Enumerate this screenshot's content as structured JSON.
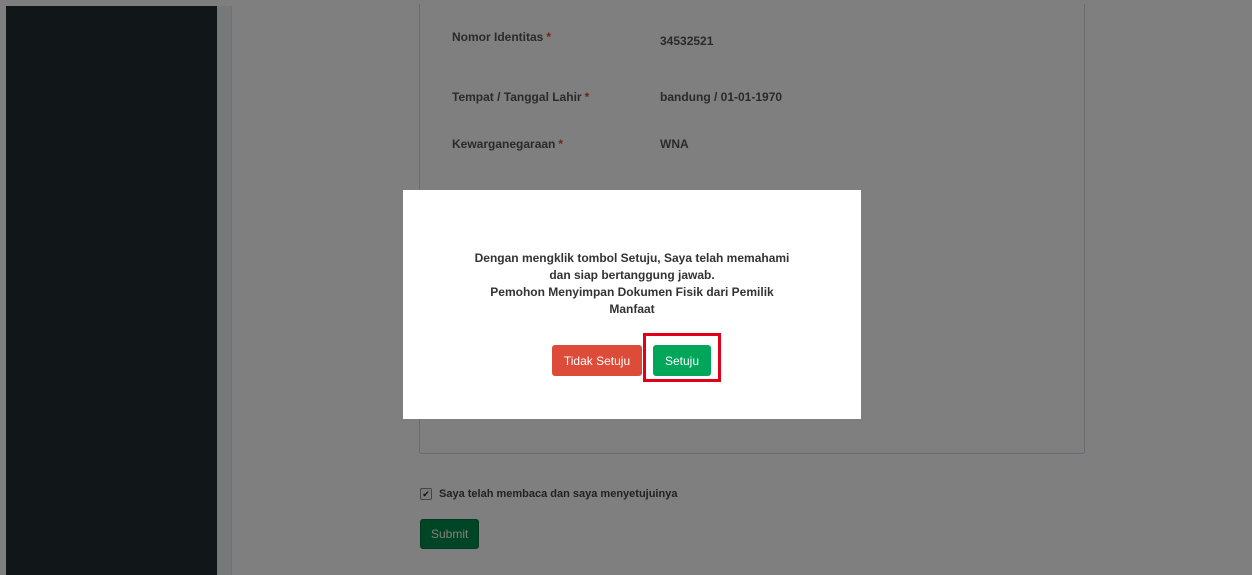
{
  "form": {
    "rows": [
      {
        "label": "Nomor Identitas",
        "required_mark": "*",
        "value": "34532521"
      },
      {
        "label": "Tempat / Tanggal Lahir",
        "required_mark": "*",
        "value": "bandung / 01-01-1970"
      },
      {
        "label": "Kewarganegaraan",
        "required_mark": "*",
        "value": "WNA"
      }
    ],
    "agree_checkbox": {
      "checked": true,
      "label": "Saya telah membaca dan saya menyetujuinya"
    },
    "submit_label": "Submit"
  },
  "modal": {
    "message_lines": [
      "Dengan mengklik tombol Setuju, Saya telah memahami",
      "dan siap bertanggung jawab.",
      "Pemohon Menyimpan Dokumen Fisik dari Pemilik",
      "Manfaat"
    ],
    "disagree_label": "Tidak Setuju",
    "agree_label": "Setuju"
  },
  "colors": {
    "sidebar": "#222d32",
    "danger": "#dd4b39",
    "success": "#00a65a",
    "submit": "#008d4c",
    "highlight": "#e0001a"
  }
}
